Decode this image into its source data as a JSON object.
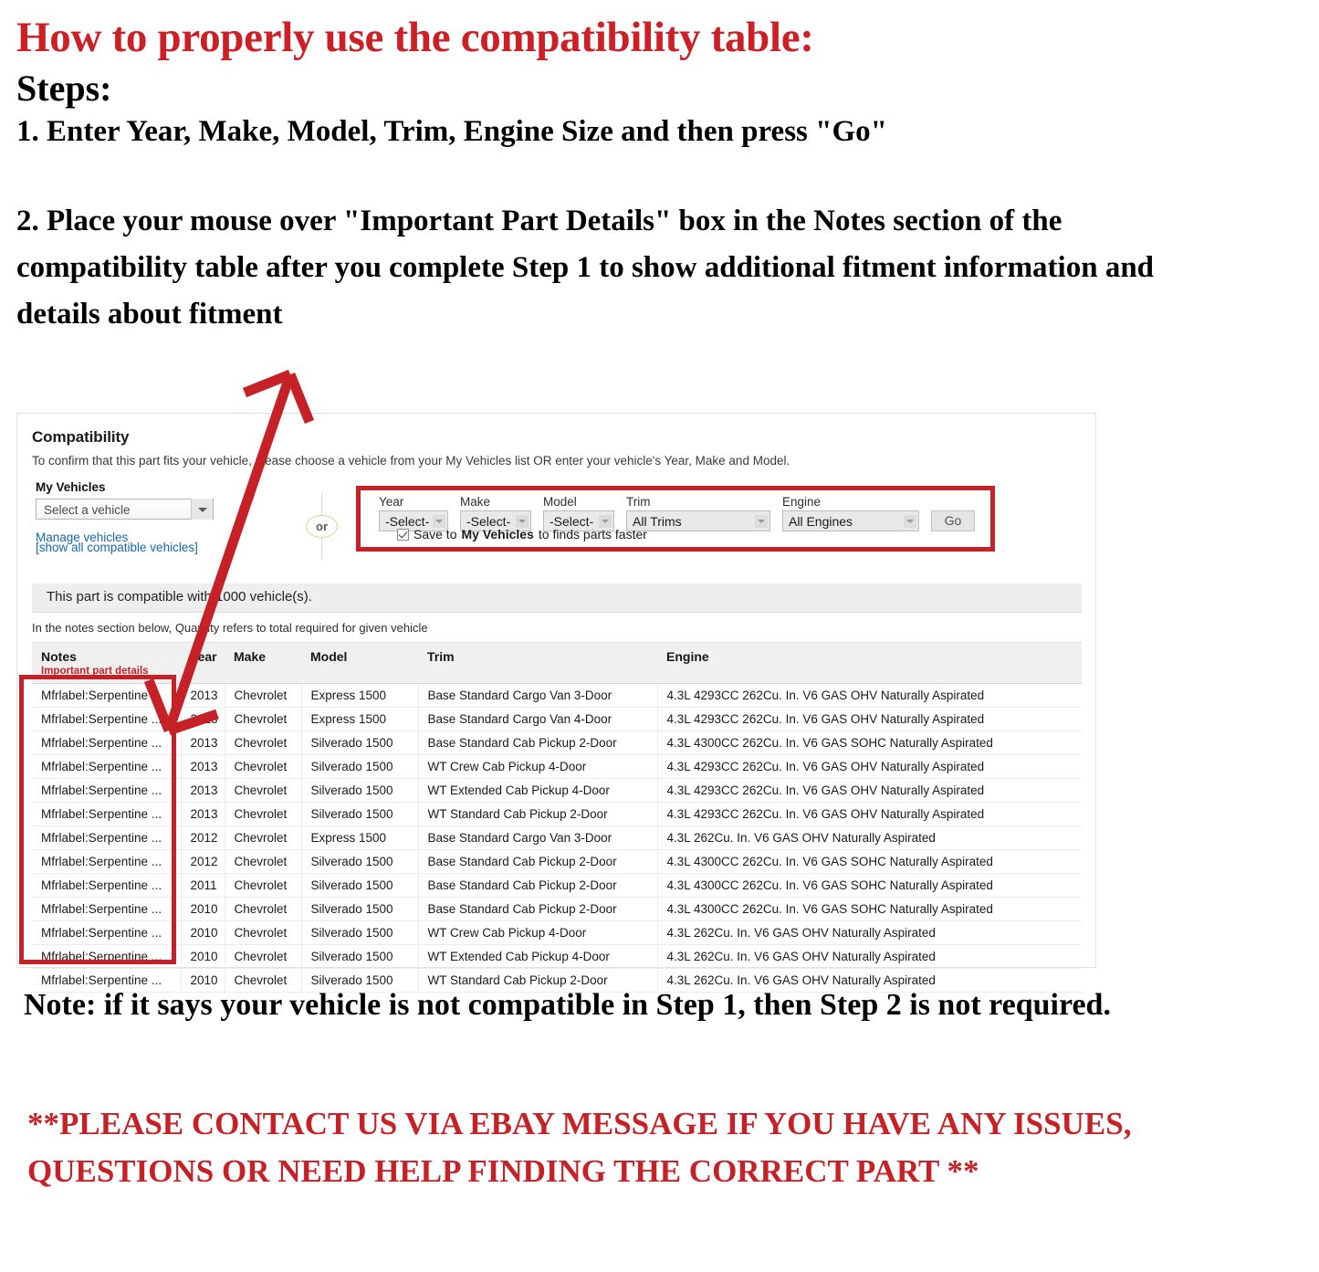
{
  "instructions": {
    "title": "How to properly use the compatibility table:",
    "steps_label": "Steps:",
    "step1": "1. Enter Year, Make, Model, Trim, Engine Size and then press \"Go\"",
    "step2": "2. Place your mouse over \"Important Part Details\" box in the Notes section of the compatibility table after you complete Step 1 to show additional fitment information and details about fitment"
  },
  "colors": {
    "accent_red": "#c62127",
    "title_red": "#cc2026",
    "link_blue": "#1569a8",
    "header_grey": "#f0f0f0"
  },
  "compatibility": {
    "heading": "Compatibility",
    "subheading": "To confirm that this part fits your vehicle, please choose a vehicle from your My Vehicles list OR enter your vehicle's Year, Make and Model.",
    "my_vehicles": {
      "label": "My Vehicles",
      "select_value": "Select a vehicle",
      "manage_link": "Manage vehicles",
      "show_all_link": "[show all compatible vehicles]"
    },
    "or_divider": "or",
    "finder": {
      "year": {
        "label": "Year",
        "value": "-Select-"
      },
      "make": {
        "label": "Make",
        "value": "-Select-"
      },
      "model": {
        "label": "Model",
        "value": "-Select-"
      },
      "trim": {
        "label": "Trim",
        "value": "All Trims"
      },
      "engine": {
        "label": "Engine",
        "value": "All Engines"
      },
      "go_button": "Go",
      "save_prefix": "Save to ",
      "save_bold": "My Vehicles",
      "save_suffix": " to finds parts faster"
    },
    "banner": "This part is compatible with 1000 vehicle(s).",
    "notes_hint": "In the notes section below, Quantity refers to total required for given vehicle"
  },
  "table": {
    "headers": {
      "notes": "Notes",
      "notes_sub": "Important part details",
      "year": "Year",
      "make": "Make",
      "model": "Model",
      "trim": "Trim",
      "engine": "Engine"
    },
    "rows": [
      {
        "notes": "Mfrlabel:Serpentine ...",
        "year": "2013",
        "make": "Chevrolet",
        "model": "Express 1500",
        "trim": "Base Standard Cargo Van 3-Door",
        "engine": "4.3L 4293CC 262Cu. In. V6 GAS OHV Naturally Aspirated"
      },
      {
        "notes": "Mfrlabel:Serpentine ...",
        "year": "2013",
        "make": "Chevrolet",
        "model": "Express 1500",
        "trim": "Base Standard Cargo Van 4-Door",
        "engine": "4.3L 4293CC 262Cu. In. V6 GAS OHV Naturally Aspirated"
      },
      {
        "notes": "Mfrlabel:Serpentine ...",
        "year": "2013",
        "make": "Chevrolet",
        "model": "Silverado 1500",
        "trim": "Base Standard Cab Pickup 2-Door",
        "engine": "4.3L 4300CC 262Cu. In. V6 GAS SOHC Naturally Aspirated"
      },
      {
        "notes": "Mfrlabel:Serpentine ...",
        "year": "2013",
        "make": "Chevrolet",
        "model": "Silverado 1500",
        "trim": "WT Crew Cab Pickup 4-Door",
        "engine": "4.3L 4293CC 262Cu. In. V6 GAS OHV Naturally Aspirated"
      },
      {
        "notes": "Mfrlabel:Serpentine ...",
        "year": "2013",
        "make": "Chevrolet",
        "model": "Silverado 1500",
        "trim": "WT Extended Cab Pickup 4-Door",
        "engine": "4.3L 4293CC 262Cu. In. V6 GAS OHV Naturally Aspirated"
      },
      {
        "notes": "Mfrlabel:Serpentine ...",
        "year": "2013",
        "make": "Chevrolet",
        "model": "Silverado 1500",
        "trim": "WT Standard Cab Pickup 2-Door",
        "engine": "4.3L 4293CC 262Cu. In. V6 GAS OHV Naturally Aspirated"
      },
      {
        "notes": "Mfrlabel:Serpentine ...",
        "year": "2012",
        "make": "Chevrolet",
        "model": "Express 1500",
        "trim": "Base Standard Cargo Van 3-Door",
        "engine": "4.3L 262Cu. In. V6 GAS OHV Naturally Aspirated"
      },
      {
        "notes": "Mfrlabel:Serpentine ...",
        "year": "2012",
        "make": "Chevrolet",
        "model": "Silverado 1500",
        "trim": "Base Standard Cab Pickup 2-Door",
        "engine": "4.3L 4300CC 262Cu. In. V6 GAS SOHC Naturally Aspirated"
      },
      {
        "notes": "Mfrlabel:Serpentine ...",
        "year": "2011",
        "make": "Chevrolet",
        "model": "Silverado 1500",
        "trim": "Base Standard Cab Pickup 2-Door",
        "engine": "4.3L 4300CC 262Cu. In. V6 GAS SOHC Naturally Aspirated"
      },
      {
        "notes": "Mfrlabel:Serpentine ...",
        "year": "2010",
        "make": "Chevrolet",
        "model": "Silverado 1500",
        "trim": "Base Standard Cab Pickup 2-Door",
        "engine": "4.3L 4300CC 262Cu. In. V6 GAS SOHC Naturally Aspirated"
      },
      {
        "notes": "Mfrlabel:Serpentine ...",
        "year": "2010",
        "make": "Chevrolet",
        "model": "Silverado 1500",
        "trim": "WT Crew Cab Pickup 4-Door",
        "engine": "4.3L 262Cu. In. V6 GAS OHV Naturally Aspirated"
      },
      {
        "notes": "Mfrlabel:Serpentine ...",
        "year": "2010",
        "make": "Chevrolet",
        "model": "Silverado 1500",
        "trim": "WT Extended Cab Pickup 4-Door",
        "engine": "4.3L 262Cu. In. V6 GAS OHV Naturally Aspirated"
      },
      {
        "notes": "Mfrlabel:Serpentine ...",
        "year": "2010",
        "make": "Chevrolet",
        "model": "Silverado 1500",
        "trim": "WT Standard Cab Pickup 2-Door",
        "engine": "4.3L 262Cu. In. V6 GAS OHV Naturally Aspirated"
      }
    ]
  },
  "footer": {
    "note": "Note: if it says your vehicle is not compatible in Step 1, then Step 2 is not required.",
    "contact": "**PLEASE CONTACT US VIA EBAY MESSAGE IF YOU HAVE ANY ISSUES, QUESTIONS OR NEED HELP FINDING THE CORRECT PART **"
  }
}
